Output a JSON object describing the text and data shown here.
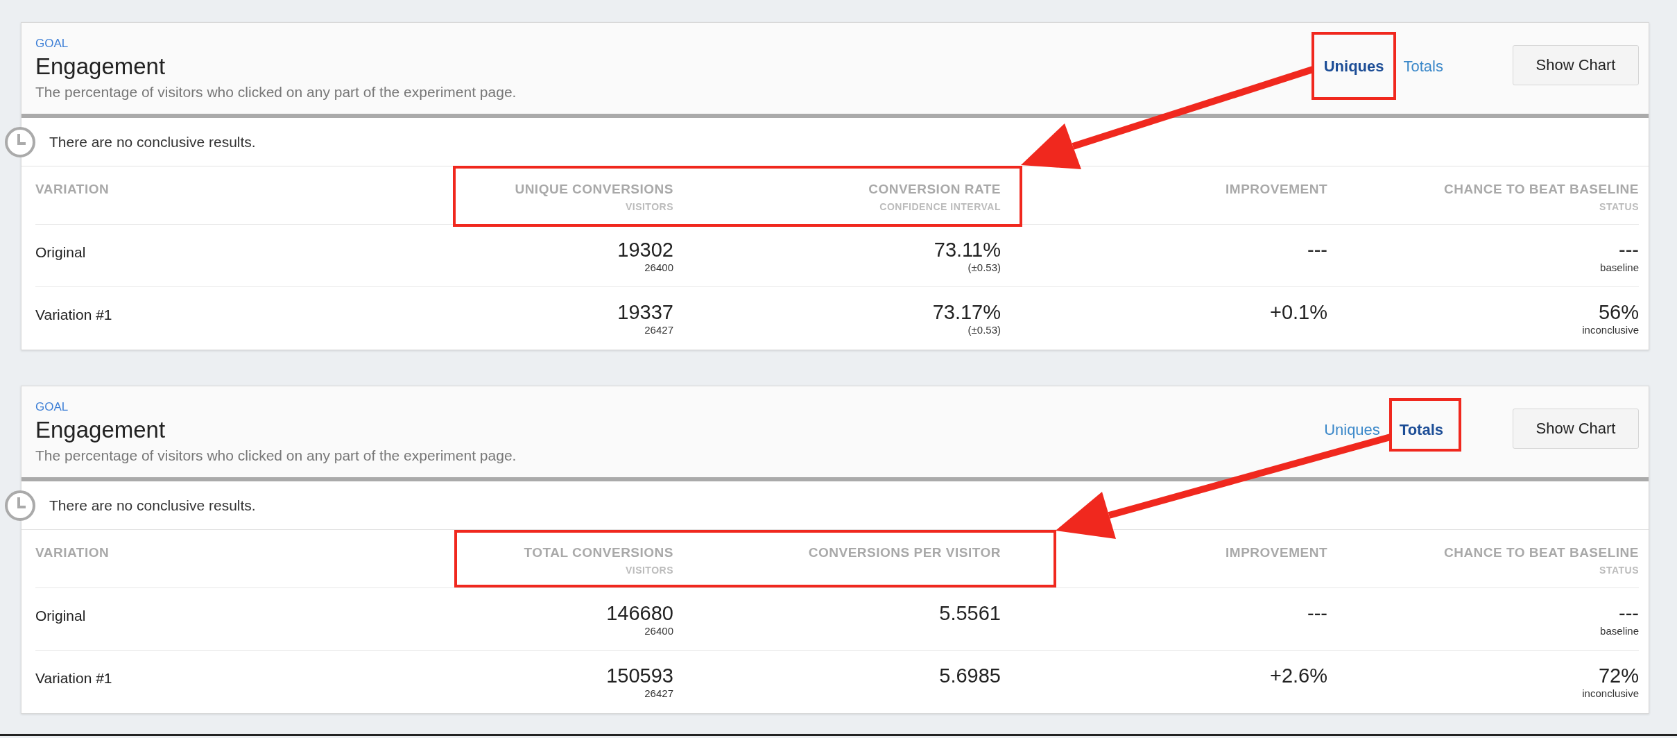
{
  "goals": [
    {
      "label": "GOAL",
      "title": "Engagement",
      "description": "The percentage of visitors who clicked on any part of the experiment page.",
      "toggles": [
        {
          "label": "Uniques",
          "selected": true
        },
        {
          "label": "Totals",
          "selected": false
        }
      ],
      "show_chart_button": "Show Chart",
      "notice": "There are no conclusive results.",
      "table": {
        "columns": [
          {
            "title": "VARIATION"
          },
          {
            "title": "UNIQUE CONVERSIONS",
            "subtitle": "VISITORS"
          },
          {
            "title": "CONVERSION RATE",
            "subtitle": "CONFIDENCE INTERVAL"
          },
          {
            "title": "IMPROVEMENT"
          },
          {
            "title": "CHANCE TO BEAT BASELINE",
            "subtitle": "STATUS"
          }
        ],
        "rows": [
          {
            "cells": [
              {
                "value": "Original"
              },
              {
                "value": "19302",
                "sub": "26400"
              },
              {
                "value": "73.11%",
                "sub": "(±0.53)"
              },
              {
                "value": "---"
              },
              {
                "value": "---",
                "sub": "baseline"
              }
            ]
          },
          {
            "cells": [
              {
                "value": "Variation #1"
              },
              {
                "value": "19337",
                "sub": "26427"
              },
              {
                "value": "73.17%",
                "sub": "(±0.53)"
              },
              {
                "value": "+0.1%"
              },
              {
                "value": "56%",
                "sub": "inconclusive"
              }
            ]
          }
        ]
      }
    },
    {
      "label": "GOAL",
      "title": "Engagement",
      "description": "The percentage of visitors who clicked on any part of the experiment page.",
      "toggles": [
        {
          "label": "Uniques",
          "selected": false
        },
        {
          "label": "Totals",
          "selected": true
        }
      ],
      "show_chart_button": "Show Chart",
      "notice": "There are no conclusive results.",
      "table": {
        "columns": [
          {
            "title": "VARIATION"
          },
          {
            "title": "TOTAL CONVERSIONS",
            "subtitle": "VISITORS"
          },
          {
            "title": "CONVERSIONS PER VISITOR"
          },
          {
            "title": "IMPROVEMENT"
          },
          {
            "title": "CHANCE TO BEAT BASELINE",
            "subtitle": "STATUS"
          }
        ],
        "rows": [
          {
            "cells": [
              {
                "value": "Original"
              },
              {
                "value": "146680",
                "sub": "26400"
              },
              {
                "value": "5.5561"
              },
              {
                "value": "---"
              },
              {
                "value": "---",
                "sub": "baseline"
              }
            ]
          },
          {
            "cells": [
              {
                "value": "Variation #1"
              },
              {
                "value": "150593",
                "sub": "26427"
              },
              {
                "value": "5.6985"
              },
              {
                "value": "+2.6%"
              },
              {
                "value": "72%",
                "sub": "inconclusive"
              }
            ]
          }
        ]
      }
    }
  ]
}
